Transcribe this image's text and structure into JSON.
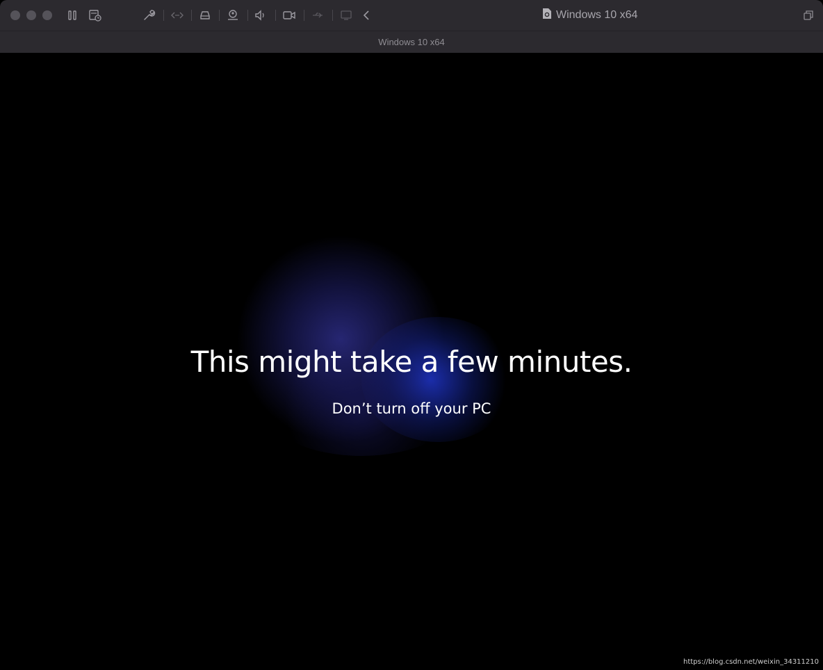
{
  "window": {
    "title": "Windows 10 x64",
    "tab_label": "Windows 10 x64"
  },
  "toolbar": {
    "icons": [
      "pause-icon",
      "snapshot-icon",
      "settings-wrench-icon",
      "code-icon",
      "hard-drive-icon",
      "user-share-icon",
      "sound-icon",
      "camera-icon",
      "usb-icon",
      "display-icon",
      "back-chevron-icon",
      "restore-window-icon"
    ]
  },
  "screen": {
    "headline": "This might take a few minutes.",
    "subline": "Don’t turn off your PC"
  },
  "watermark": "https://blog.csdn.net/weixin_34311210",
  "colors": {
    "titlebar": "#2c2a2f",
    "screen_bg": "#000000",
    "glow_blue": "#2a2ad0",
    "text": "#ffffff"
  }
}
